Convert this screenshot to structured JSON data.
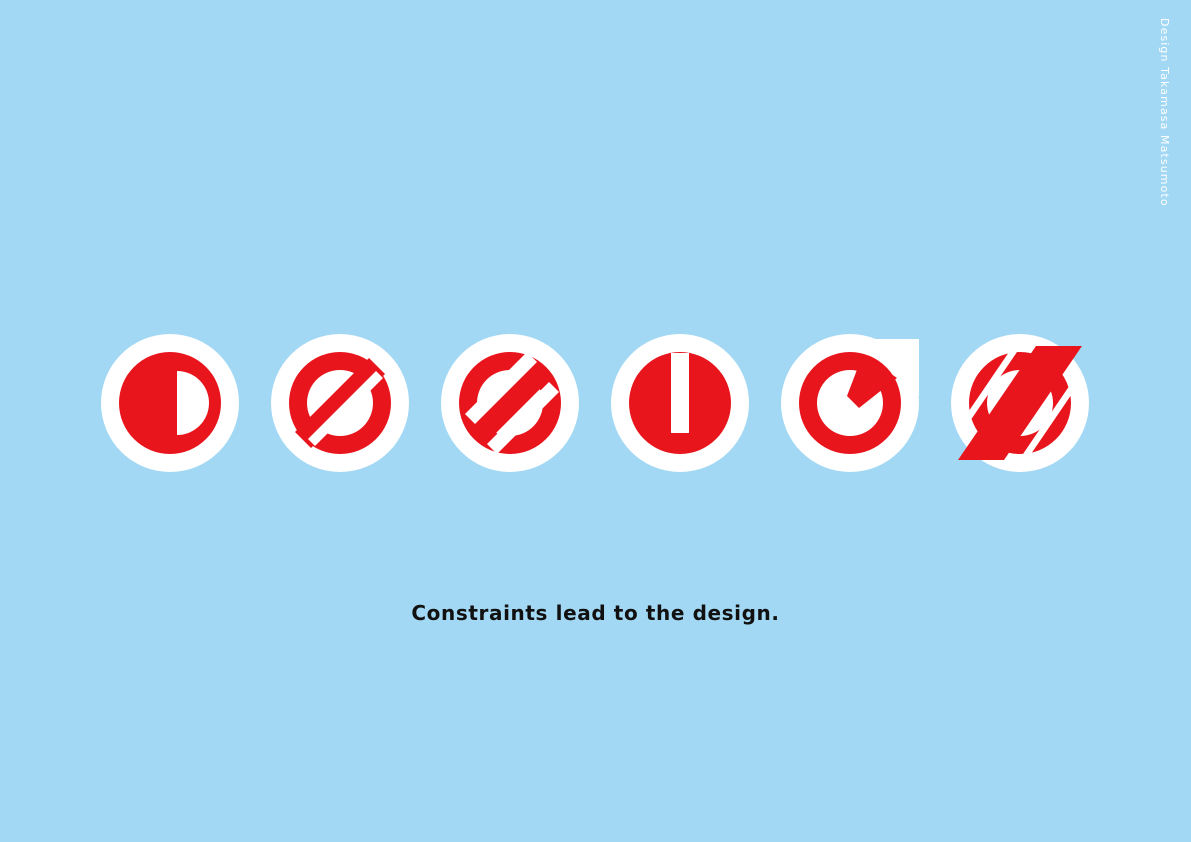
{
  "poster": {
    "credit": "Design Takamasa Matsumoto",
    "tagline": "Constraints lead to the design.",
    "word_in_glyphs": "DESIGN",
    "glyphs": [
      {
        "letter": "D",
        "icon": "letter-d-icon"
      },
      {
        "letter": "E",
        "icon": "letter-e-icon"
      },
      {
        "letter": "S",
        "icon": "letter-s-icon"
      },
      {
        "letter": "I",
        "icon": "letter-i-icon"
      },
      {
        "letter": "G",
        "icon": "letter-g-icon"
      },
      {
        "letter": "N",
        "icon": "letter-n-icon"
      }
    ]
  },
  "colors": {
    "background": "#a2d8f4",
    "badge": "#ffffff",
    "mark": "#e8151c",
    "text": "#111111"
  }
}
